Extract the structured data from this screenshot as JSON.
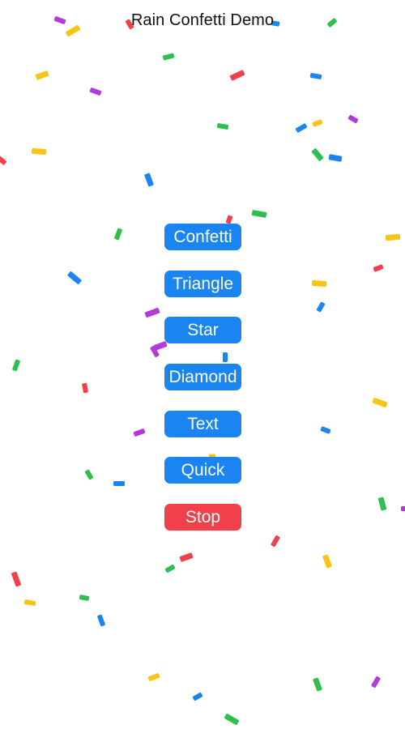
{
  "title": "Rain Confetti Demo",
  "buttons": [
    {
      "label": "Confetti",
      "style": "primary"
    },
    {
      "label": "Triangle",
      "style": "primary"
    },
    {
      "label": "Star",
      "style": "primary"
    },
    {
      "label": "Diamond",
      "style": "primary"
    },
    {
      "label": "Text",
      "style": "primary"
    },
    {
      "label": "Quick",
      "style": "primary"
    },
    {
      "label": "Stop",
      "style": "danger"
    }
  ],
  "colors": {
    "accent": "#1a84f0",
    "danger": "#f2404a",
    "confetti": [
      "#f5c518",
      "#2fbf4f",
      "#1a84f0",
      "#f2404a",
      "#b23ad8"
    ]
  }
}
